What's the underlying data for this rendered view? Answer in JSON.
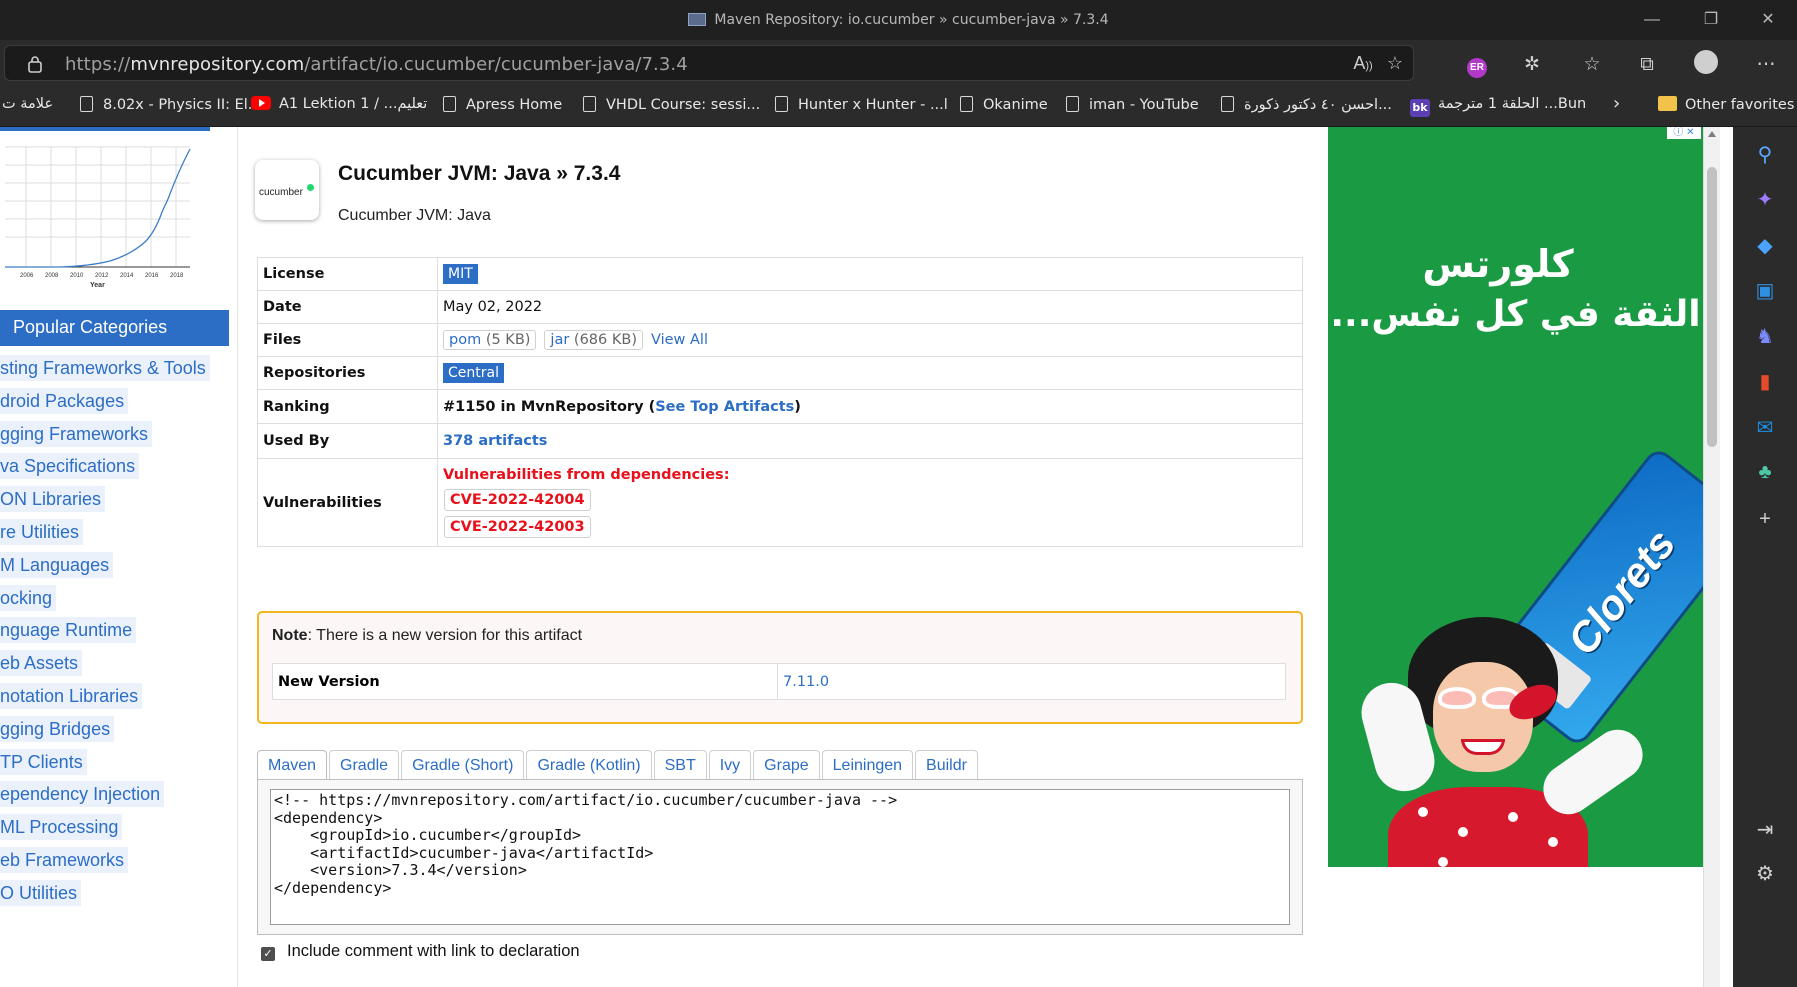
{
  "browser": {
    "window_title": "Maven Repository: io.cucumber » cucumber-java » 7.3.4",
    "url_prefix": "https://",
    "url_host": "mvnrepository.com",
    "url_path": "/artifact/io.cucumber/cucumber-java/7.3.4",
    "favorites": [
      {
        "label": "علامة ت",
        "icon": "none"
      },
      {
        "label": "8.02x - Physics II: El...",
        "icon": "page-icon"
      },
      {
        "label": "A1 Lektion 1 / ...تعليم",
        "icon": "youtube-icon"
      },
      {
        "label": "Apress Home",
        "icon": "page-icon"
      },
      {
        "label": "VHDL Course: sessi...",
        "icon": "page-icon"
      },
      {
        "label": "Hunter x Hunter - ...l",
        "icon": "page-icon"
      },
      {
        "label": "Okanime",
        "icon": "page-icon"
      },
      {
        "label": "iman - YouTube",
        "icon": "page-icon"
      },
      {
        "label": "احسن ٤٠ دكتور ذكورة...",
        "icon": "page-icon"
      },
      {
        "label": "الحلقة 1 مترجمة ...Bun",
        "icon": "bk-icon"
      }
    ],
    "other_favorites": "Other favorites",
    "profile_initials": "ER"
  },
  "sidebar_left": {
    "popular_categories": "Popular Categories",
    "categories": [
      "sting Frameworks & Tools",
      "droid Packages",
      "gging Frameworks",
      "va Specifications",
      "ON Libraries",
      "re Utilities",
      "M Languages",
      "ocking",
      "nguage Runtime",
      "eb Assets",
      "notation Libraries",
      "gging Bridges",
      "TP Clients",
      "ependency Injection",
      "ML Processing",
      "eb Frameworks",
      "O Utilities"
    ],
    "chart_xlabel": "Year",
    "chart_years": [
      "2006",
      "2008",
      "2010",
      "2012",
      "2014",
      "2016",
      "2018"
    ]
  },
  "artifact": {
    "logo_text": "cucumber",
    "title": "Cucumber JVM: Java » 7.3.4",
    "subtitle": "Cucumber JVM: Java",
    "rows": {
      "license_label": "License",
      "license_value": "MIT",
      "date_label": "Date",
      "date_value": "May 02, 2022",
      "files_label": "Files",
      "file_pom_name": "pom",
      "file_pom_size": "(5 KB)",
      "file_jar_name": "jar",
      "file_jar_size": "(686 KB)",
      "view_all": "View All",
      "repos_label": "Repositories",
      "repos_value": "Central",
      "ranking_label": "Ranking",
      "ranking_prefix": "#1150 in MvnRepository (",
      "ranking_link": "See Top Artifacts",
      "ranking_suffix": ")",
      "usedby_label": "Used By",
      "usedby_value": "378 artifacts",
      "vuln_label": "Vulnerabilities",
      "vuln_title": "Vulnerabilities from dependencies:",
      "cves": [
        "CVE-2022-42004",
        "CVE-2022-42003"
      ]
    }
  },
  "note": {
    "bold": "Note",
    "text": ": There is a new version for this artifact",
    "new_version_label": "New Version",
    "new_version_value": "7.11.0"
  },
  "tabs": [
    "Maven",
    "Gradle",
    "Gradle (Short)",
    "Gradle (Kotlin)",
    "SBT",
    "Ivy",
    "Grape",
    "Leiningen",
    "Buildr"
  ],
  "active_tab": "Maven",
  "code": "<!-- https://mvnrepository.com/artifact/io.cucumber/cucumber-java -->\n<dependency>\n    <groupId>io.cucumber</groupId>\n    <artifactId>cucumber-java</artifactId>\n    <version>7.3.4</version>\n</dependency>",
  "include_comment": "Include comment with link to declaration",
  "ad": {
    "line1": "كلورتس",
    "line2": "الثقة في كل نفس...",
    "brand": "Clorets",
    "bg_color": "#1a9a43"
  }
}
